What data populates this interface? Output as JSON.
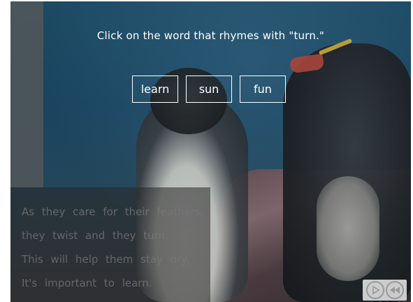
{
  "question": {
    "prompt": "Click on the word that rhymes with \"turn.\""
  },
  "answers": [
    {
      "label": "learn"
    },
    {
      "label": "sun"
    },
    {
      "label": "fun"
    }
  ],
  "story": {
    "lines": [
      "As they care for their feathers,",
      "they twist and they turn.",
      "This will help them stay dry.",
      "It's important to learn."
    ]
  },
  "controls": {
    "play_icon": "play-icon",
    "rewind_icon": "rewind-icon",
    "color": "#9a9a9a"
  }
}
